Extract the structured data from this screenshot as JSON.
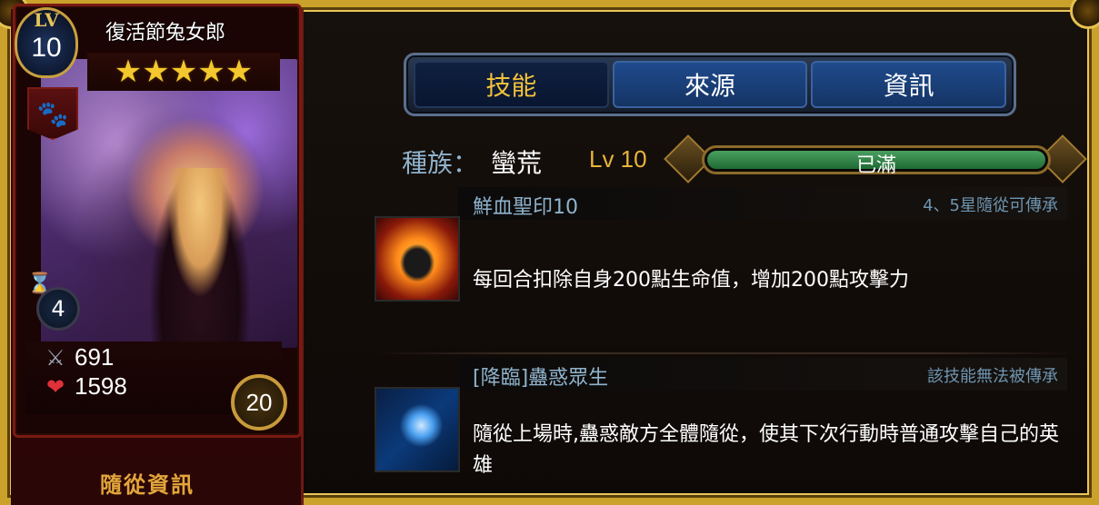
{
  "hero": {
    "lv_label": "LV",
    "level": "10",
    "name": "復活節兔女郎",
    "stars": "★★★★★",
    "cost": "4",
    "attack": "691",
    "hp": "1598",
    "rank": "20",
    "footer_label": "隨從資訊"
  },
  "tabs": [
    {
      "label": "技能",
      "active": true
    },
    {
      "label": "來源",
      "active": false
    },
    {
      "label": "資訊",
      "active": false
    }
  ],
  "race": {
    "label": "種族：",
    "value": "蠻荒",
    "level_text": "Lv 10",
    "exp_status": "已滿",
    "exp_progress": 1.0
  },
  "skills": [
    {
      "name": "鮮血聖印10",
      "inherit": "4、5星隨從可傳承",
      "description": "每回合扣除自身200點生命值，增加200點攻擊力",
      "icon": "blood-seal-icon"
    },
    {
      "name": "[降臨]蠱惑眾生",
      "inherit": "該技能無法被傳承",
      "description": "隨從上場時,蠱惑敵方全體隨從，使其下次行動時普通攻擊自己的英雄",
      "icon": "charm-spear-icon"
    }
  ],
  "colors": {
    "frame_gold": "#c9a12b",
    "tab_active_text": "#f3c23b",
    "label_blue": "#8fb3cc",
    "level_gold": "#e7b43a",
    "exp_green": "#2f8a48"
  }
}
